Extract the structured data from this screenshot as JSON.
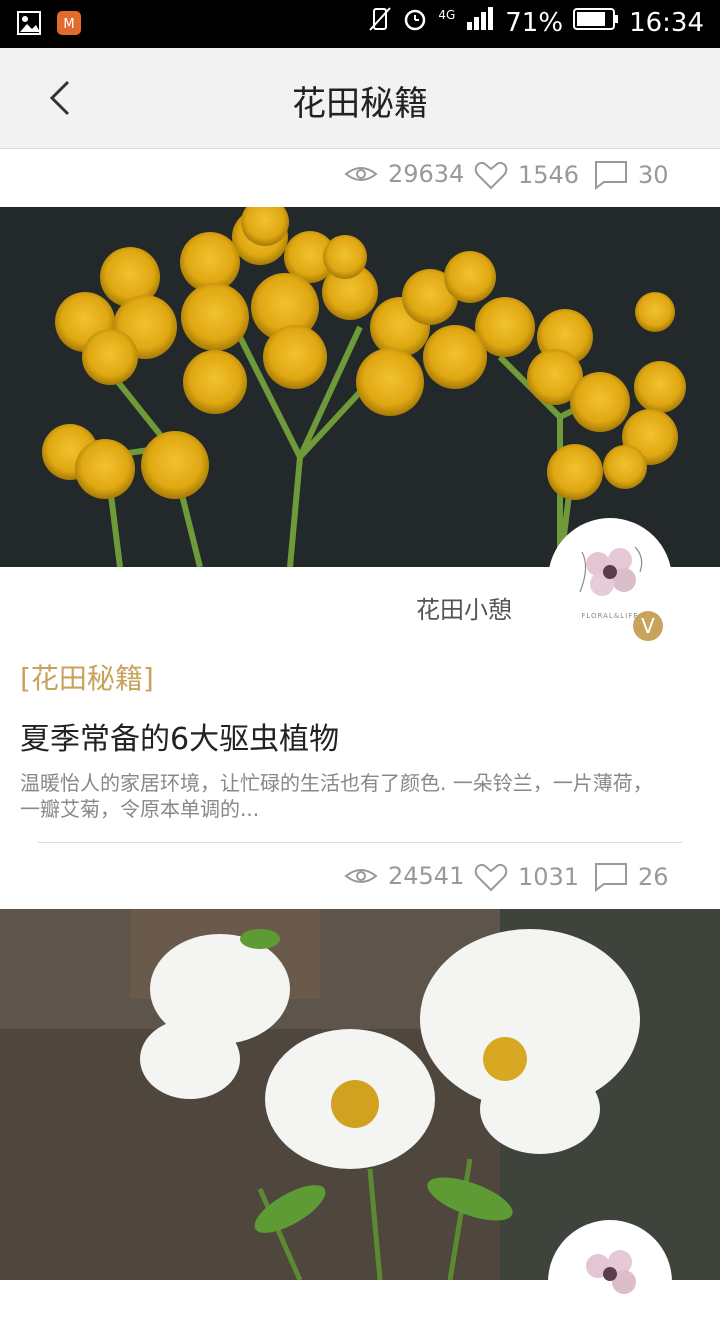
{
  "status_bar": {
    "signal": "4G",
    "battery_percent": "71%",
    "time": "16:34",
    "icons": [
      "image-icon",
      "app-icon",
      "signal-icon",
      "alarm-icon",
      "battery-icon"
    ]
  },
  "nav": {
    "title": "花田秘籍"
  },
  "feed": {
    "post1_stats": {
      "views": "29634",
      "likes": "1546",
      "comments": "30"
    },
    "post2": {
      "author": "花田小憩",
      "badge": "V",
      "category": "[花田秘籍]",
      "title": "夏季常备的6大驱虫植物",
      "summary": "温暖怡人的家居环境，让忙碌的生活也有了颜色. 一朵铃兰，一片薄荷，一瓣艾菊，令原本单调的...",
      "stats": {
        "views": "24541",
        "likes": "1031",
        "comments": "26"
      }
    }
  },
  "colors": {
    "accent": "#c8a35b",
    "muted": "#999999",
    "text": "#222222"
  }
}
